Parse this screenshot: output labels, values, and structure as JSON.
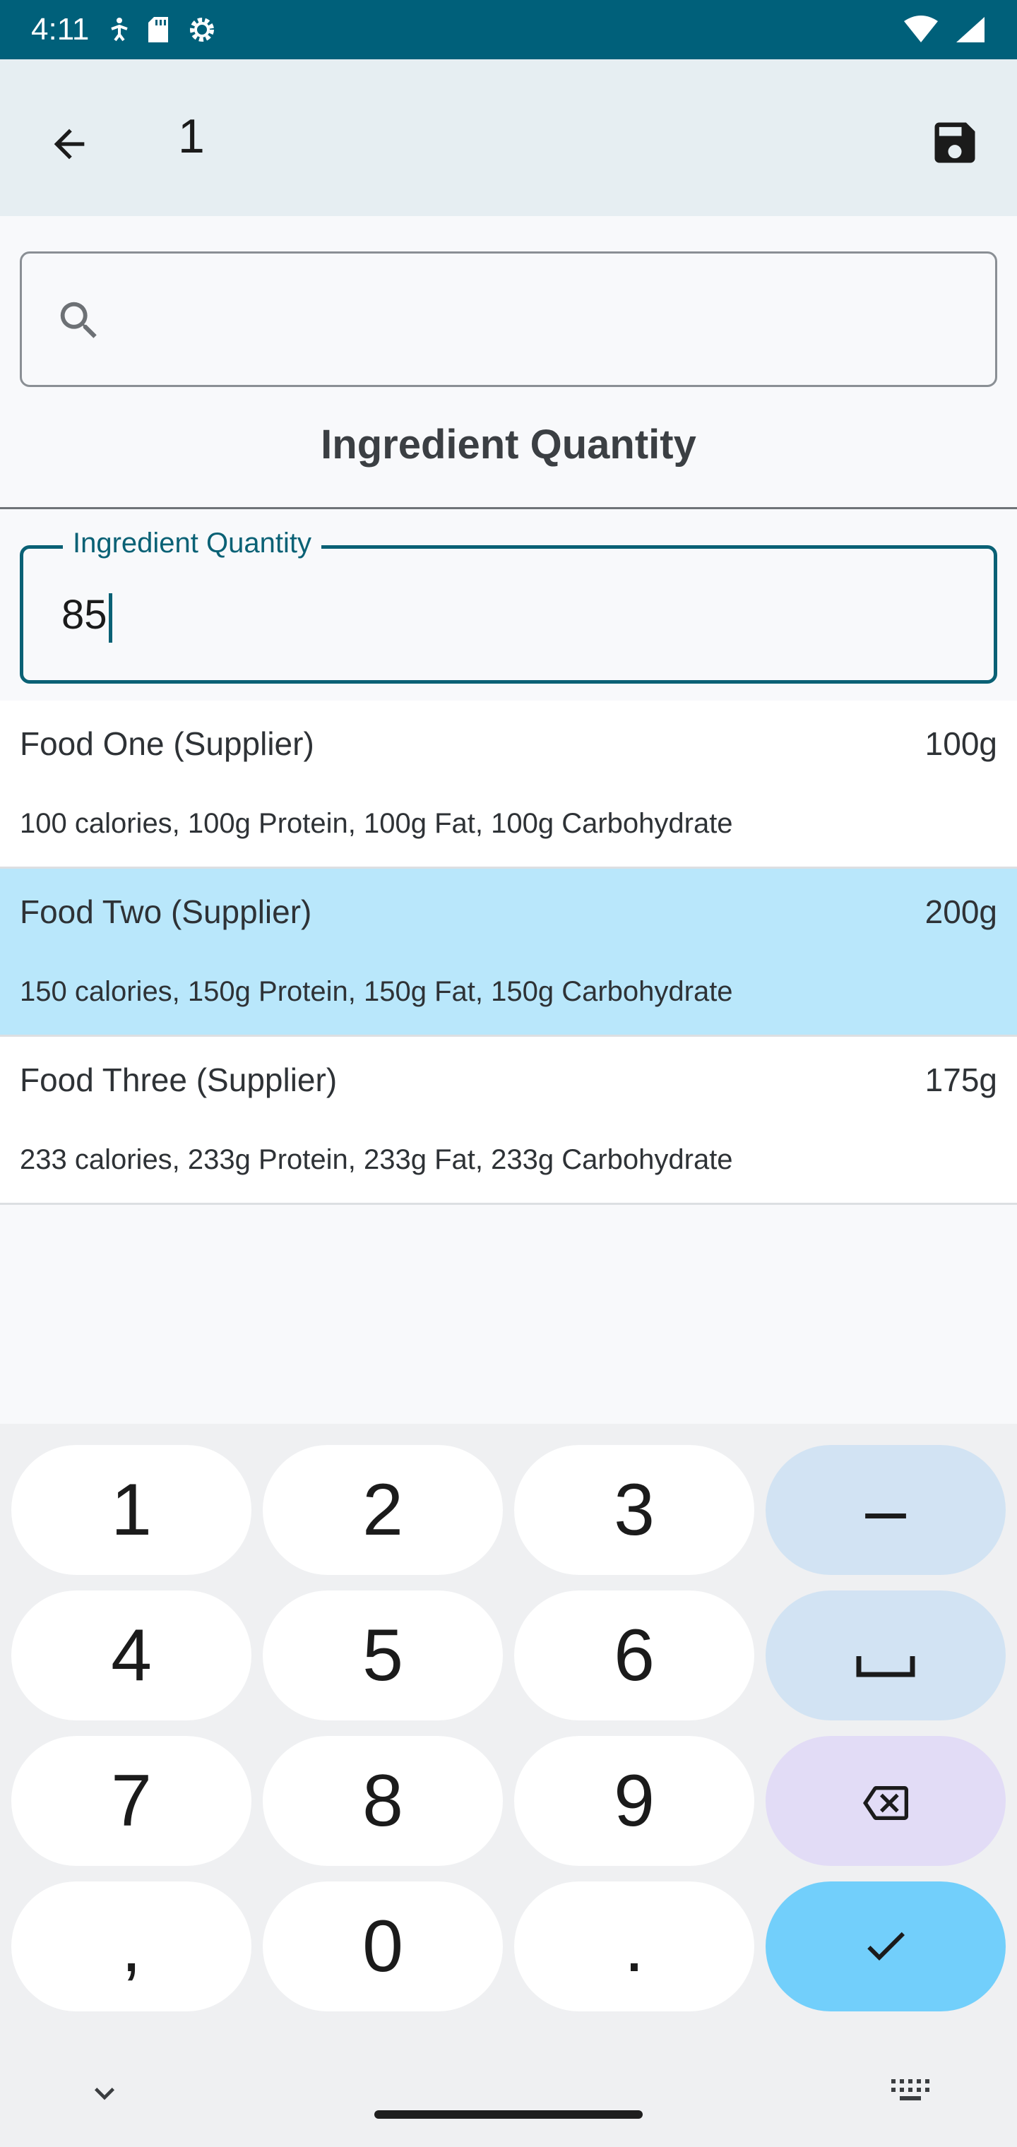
{
  "status_bar": {
    "time": "4:11",
    "icons": [
      "accessibility-icon",
      "sd-card-icon",
      "settings-gear-icon",
      "wifi-icon",
      "cellular-signal-icon"
    ]
  },
  "app_bar": {
    "title": "1",
    "back_icon": "arrow-left-icon",
    "save_icon": "save-floppy-icon"
  },
  "search": {
    "value": "",
    "placeholder": ""
  },
  "section_title": "Ingredient Quantity",
  "quantity_field": {
    "label": "Ingredient Quantity",
    "value": "85"
  },
  "foods": [
    {
      "name": "Food One (Supplier)",
      "weight": "100g",
      "nutrition": "100 calories, 100g Protein, 100g Fat, 100g Carbohydrate",
      "selected": false
    },
    {
      "name": "Food Two (Supplier)",
      "weight": "200g",
      "nutrition": "150 calories, 150g Protein, 150g Fat, 150g Carbohydrate",
      "selected": true
    },
    {
      "name": "Food Three (Supplier)",
      "weight": "175g",
      "nutrition": "233 calories, 233g Protein, 233g Fat, 233g Carbohydrate",
      "selected": false
    }
  ],
  "keyboard": {
    "keys": {
      "k1": "1",
      "k2": "2",
      "k3": "3",
      "minus": "–",
      "k4": "4",
      "k5": "5",
      "k6": "6",
      "k7": "7",
      "k8": "8",
      "k9": "9",
      "comma": ",",
      "k0": "0",
      "period": "."
    },
    "icons": [
      "space-icon",
      "backspace-icon",
      "check-icon",
      "chevron-down-icon",
      "keyboard-icon"
    ]
  },
  "colors": {
    "status_bar": "#00607a",
    "accent": "#0a6175",
    "selected_row": "#b9e7fb",
    "done_key": "#72cffb"
  }
}
